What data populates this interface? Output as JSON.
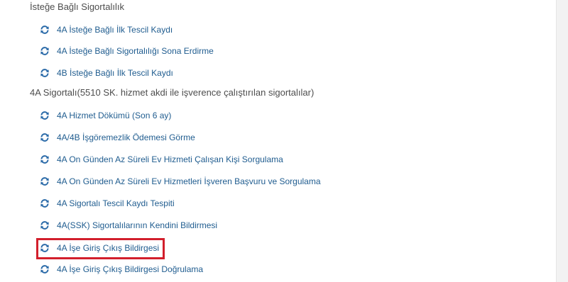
{
  "sections": [
    {
      "title": "İsteğe Bağlı Sigortalılık",
      "items": [
        {
          "label": "4A İsteğe Bağlı İlk Tescil Kaydı",
          "icon": "refresh-icon"
        },
        {
          "label": "4A İsteğe Bağlı Sigortalılığı Sona Erdirme",
          "icon": "refresh-icon"
        },
        {
          "label": "4B İsteğe Bağlı İlk Tescil Kaydı",
          "icon": "refresh-icon"
        }
      ]
    },
    {
      "title": "4A Sigortalı(5510 SK. hizmet akdi ile işverence çalıştırılan sigortalılar)",
      "items": [
        {
          "label": "4A Hizmet Dökümü (Son 6 ay)",
          "icon": "refresh-icon"
        },
        {
          "label": "4A/4B İşgöremezlik Ödemesi Görme",
          "icon": "refresh-icon"
        },
        {
          "label": "4A On Günden Az Süreli Ev Hizmeti Çalışan Kişi Sorgulama",
          "icon": "refresh-icon"
        },
        {
          "label": "4A On Günden Az Süreli Ev Hizmetleri İşveren Başvuru ve Sorgulama",
          "icon": "refresh-icon"
        },
        {
          "label": "4A Sigortalı Tescil Kaydı Tespiti",
          "icon": "refresh-icon"
        },
        {
          "label": "4A(SSK) Sigortalılarının Kendini Bildirmesi",
          "icon": "refresh-icon"
        },
        {
          "label": "4A İşe Giriş Çıkış Bildirgesi",
          "icon": "refresh-icon",
          "highlighted": true
        },
        {
          "label": "4A İşe Giriş Çıkış Bildirgesi Doğrulama",
          "icon": "refresh-icon"
        }
      ]
    }
  ],
  "colors": {
    "link": "#1f5c8f",
    "icon": "#2a6aa8",
    "header": "#4d4d4d",
    "highlight": "#d21f2c"
  }
}
